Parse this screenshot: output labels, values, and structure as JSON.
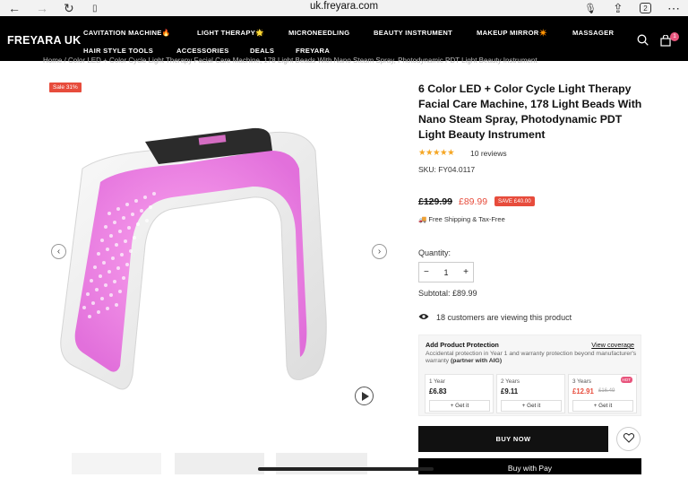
{
  "browser": {
    "url": "uk.freyara.com",
    "tab_count": "2",
    "back_icon": "arrow-left",
    "forward_icon": "arrow-right",
    "reload_icon": "reload",
    "more_icon": "ellipsis"
  },
  "header": {
    "logo": "FREYARA UK",
    "nav_row1": [
      "CAVITATION MACHINE🔥",
      "LIGHT THERAPY🌟",
      "MICRONEEDLING",
      "BEAUTY INSTRUMENT",
      "MAKEUP MIRROR✴️",
      "MASSAGER"
    ],
    "nav_row2": [
      "HAIR STYLE TOOLS",
      "ACCESSORIES",
      "DEALS",
      "FREYARA"
    ],
    "cart_count": "1"
  },
  "breadcrumb": "Home / Color LED + Color Cycle Light Therapy Facial Care Machine, 178 Light Beads With Nano Steam Spray, Photodynamic PDT Light Beauty Instrument",
  "gallery": {
    "sale_badge": "Sale 31%"
  },
  "product": {
    "title": "6 Color LED + Color Cycle Light Therapy Facial Care Machine, 178 Light Beads With Nano Steam Spray, Photodynamic PDT Light Beauty Instrument",
    "stars": "★★★★★",
    "rating": 5,
    "reviews": "10 reviews",
    "sku": "SKU:  FY04.0117",
    "old_price": "£129.99",
    "price": "£89.99",
    "save_badge": "SAVE £40.00",
    "shipping": "🚚 Free Shipping & Tax-Free",
    "quantity_label": "Quantity:",
    "quantity": "1",
    "subtotal": "Subtotal: £89.99",
    "viewing": "18 customers are viewing this product"
  },
  "protection": {
    "title": "Add Product Protection",
    "link": "View coverage",
    "desc_pre": "Accidental protection in Year 1 and warranty protection beyond manufacturer's warranty ",
    "desc_bold": "(partner with AIG)",
    "plans": [
      {
        "term": "1 Year",
        "price": "£6.83",
        "was": "",
        "button": "+ Get it"
      },
      {
        "term": "2 Years",
        "price": "£9.11",
        "was": "",
        "button": "+ Get it"
      },
      {
        "term": "3 Years",
        "price": "£12.91",
        "was": "£16.49",
        "button": "+ Get it",
        "badge": "HOT"
      }
    ]
  },
  "actions": {
    "buy_now": "BUY NOW",
    "apple_pay": "Buy with  Pay"
  },
  "colors": {
    "header_bg": "#000000",
    "sale_red": "#e74c3c",
    "led_pink": "#e05ad8",
    "star": "#f5a623"
  }
}
